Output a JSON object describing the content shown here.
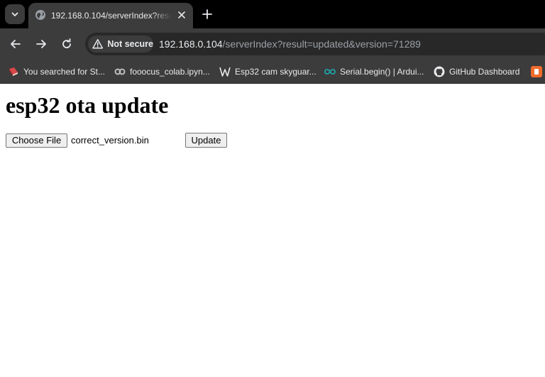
{
  "browser": {
    "tab": {
      "title": "192.168.0.104/serverIndex?result=updated&version=71289"
    },
    "address_bar": {
      "security_label": "Not secure",
      "url_host": "192.168.0.104",
      "url_rest": "/serverIndex?result=updated&version=71289"
    },
    "bookmarks": [
      {
        "label": "You searched for St...",
        "icon": "red-book-icon"
      },
      {
        "label": "fooocus_colab.ipyn...",
        "icon": "colab-icon"
      },
      {
        "label": "Esp32 cam skyguar...",
        "icon": "wordpress-w-icon"
      },
      {
        "label": "Serial.begin() | Ardui...",
        "icon": "arduino-icon"
      },
      {
        "label": "GitHub Dashboard",
        "icon": "github-icon"
      }
    ],
    "colors": {
      "titlebar": "#000000",
      "toolbar": "#3c3c3c",
      "omnibox": "#282828",
      "text_light": "#e8eaed",
      "text_dim": "#9aa0a6"
    }
  },
  "page": {
    "heading": "esp32 ota update",
    "choose_file_label": "Choose File",
    "selected_file": "correct_version.bin",
    "update_label": "Update"
  }
}
